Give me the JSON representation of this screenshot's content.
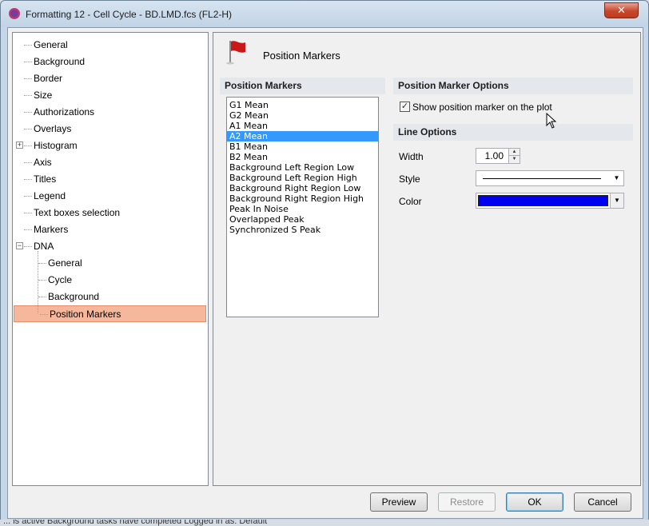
{
  "window": {
    "title": "Formatting 12 - Cell Cycle - BD.LMD.fcs (FL2-H)",
    "close_glyph": "✕"
  },
  "tree": {
    "items": [
      {
        "label": "General"
      },
      {
        "label": "Background"
      },
      {
        "label": "Border"
      },
      {
        "label": "Size"
      },
      {
        "label": "Authorizations"
      },
      {
        "label": "Overlays"
      },
      {
        "label": "Histogram",
        "expander": "+"
      },
      {
        "label": "Axis"
      },
      {
        "label": "Titles"
      },
      {
        "label": "Legend"
      },
      {
        "label": "Text boxes selection"
      },
      {
        "label": "Markers"
      },
      {
        "label": "DNA",
        "expander": "−"
      },
      {
        "label": "General"
      },
      {
        "label": "Cycle"
      },
      {
        "label": "Background"
      },
      {
        "label": "Position Markers",
        "selected": true
      }
    ]
  },
  "page": {
    "title": "Position Markers",
    "flag_color": "#c81818"
  },
  "markers_list": {
    "header": "Position Markers",
    "items": [
      "G1 Mean",
      "G2 Mean",
      "A1 Mean",
      "A2 Mean",
      "B1 Mean",
      "B2 Mean",
      "Background Left Region Low",
      "Background Left Region High",
      "Background Right Region Low",
      "Background Right Region High",
      "Peak In Noise",
      "Overlapped Peak",
      "Synchronized S Peak"
    ],
    "selected_index": 3
  },
  "options": {
    "header": "Position Marker Options",
    "show_marker_label": "Show position marker on the plot",
    "show_marker_checked": true,
    "check_glyph": "✓"
  },
  "line_options": {
    "header": "Line Options",
    "width_label": "Width",
    "width_value": "1.00",
    "style_label": "Style",
    "color_label": "Color",
    "color_value": "#0000f0",
    "dropdown_glyph": "▼",
    "spin_up_glyph": "▲",
    "spin_down_glyph": "▼"
  },
  "buttons": {
    "preview": "Preview",
    "restore": "Restore",
    "ok": "OK",
    "cancel": "Cancel"
  },
  "statusbar": {
    "text": "... is active   Background tasks have completed   Logged in as: Default"
  }
}
